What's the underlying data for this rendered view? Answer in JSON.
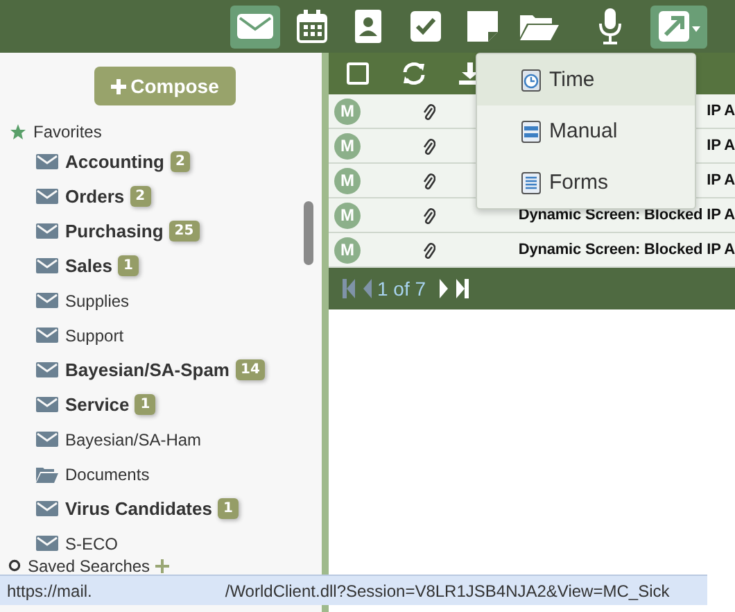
{
  "top_bar": {
    "apps": [
      {
        "kind": "mail",
        "selected": true
      },
      {
        "kind": "calendar",
        "selected": false
      },
      {
        "kind": "contacts",
        "selected": false
      },
      {
        "kind": "tasks",
        "selected": false
      },
      {
        "kind": "notes",
        "selected": false
      },
      {
        "kind": "documents",
        "selected": false
      },
      {
        "kind": "voice",
        "selected": false
      },
      {
        "kind": "launch",
        "selected": true
      }
    ]
  },
  "sidebar": {
    "compose": "Compose",
    "favorites_label": "Favorites",
    "folders": [
      {
        "name": "Accounting",
        "unread": true,
        "count": "2",
        "kind": "mail"
      },
      {
        "name": "Orders",
        "unread": true,
        "count": "2",
        "kind": "mail"
      },
      {
        "name": "Purchasing",
        "unread": true,
        "count": "25",
        "kind": "mail"
      },
      {
        "name": "Sales",
        "unread": true,
        "count": "1",
        "kind": "mail"
      },
      {
        "name": "Supplies",
        "unread": false,
        "kind": "mail"
      },
      {
        "name": "Support",
        "unread": false,
        "kind": "mail"
      },
      {
        "name": "Bayesian/SA-Spam",
        "unread": true,
        "count": "14",
        "kind": "mail"
      },
      {
        "name": "Service",
        "unread": true,
        "count": "1",
        "kind": "mail"
      },
      {
        "name": "Bayesian/SA-Ham",
        "unread": false,
        "kind": "mail"
      },
      {
        "name": "Documents",
        "unread": false,
        "kind": "folder"
      },
      {
        "name": "Virus Candidates",
        "unread": true,
        "count": "1",
        "kind": "mail"
      },
      {
        "name": "S-ECO",
        "unread": false,
        "kind": "mail"
      }
    ],
    "saved_searches": "Saved Searches"
  },
  "message_list": {
    "rows": [
      {
        "avatar": "M",
        "subject": "IP A"
      },
      {
        "avatar": "M",
        "subject": "IP A"
      },
      {
        "avatar": "M",
        "subject": "IP A"
      },
      {
        "avatar": "M",
        "subject": "Dynamic Screen: Blocked IP A"
      },
      {
        "avatar": "M",
        "subject": "Dynamic Screen: Blocked IP A"
      }
    ],
    "pager": {
      "text": "1 of 7",
      "first_disabled": true,
      "last_disabled": false
    }
  },
  "launch_menu": {
    "items": [
      {
        "label": "Time",
        "kind": "time",
        "highlighted": true
      },
      {
        "label": "Manual",
        "kind": "manual",
        "highlighted": false
      },
      {
        "label": "Forms",
        "kind": "forms",
        "highlighted": false
      }
    ]
  },
  "status_bar": {
    "url_start": "https://mail.",
    "url_end": "/WorldClient.dll?Session=V8LR1JSB4NJA2&View=MC_Sick"
  }
}
